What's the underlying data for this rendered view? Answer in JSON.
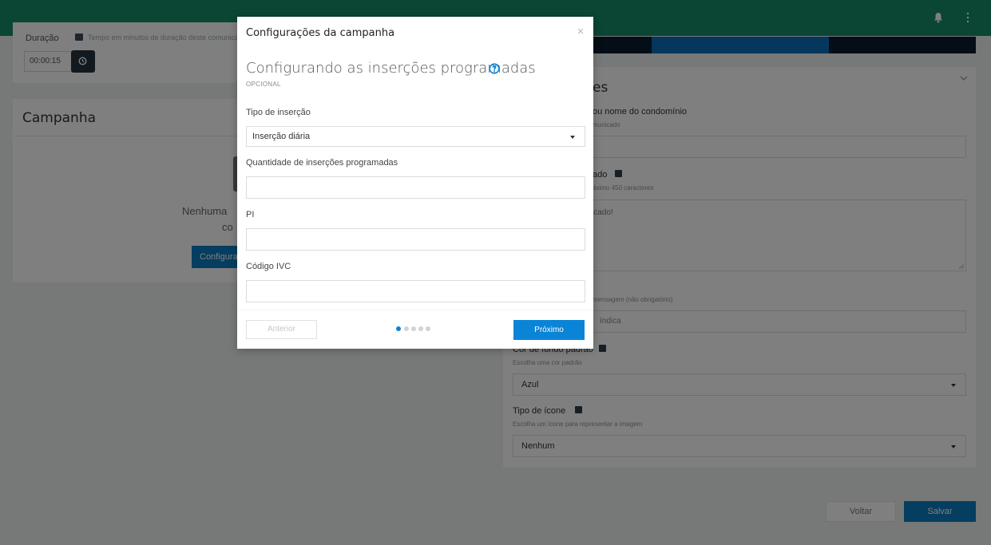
{
  "colors": {
    "topbar": "#178a66",
    "primary": "#0a7cc1",
    "modal_primary": "#0a84d6"
  },
  "topbar": {
    "icons": [
      "bell-icon",
      "kebab-menu-icon"
    ]
  },
  "duration": {
    "label": "Duração",
    "hint": "Tempo em minutos de duração deste comunicado",
    "value": "00:00:15",
    "icon": "clock-icon"
  },
  "campaign": {
    "title": "Campanha",
    "empty_text_line1": "Nenhuma",
    "empty_text_line2": "co",
    "configure_button": "Configurar"
  },
  "right_panel": {
    "title_fragment": "es",
    "name_label_fragment": "ou nome do condomínio",
    "name_hint_fragment": "municado",
    "message_label_fragment": "ado",
    "message_hint_fragment": "áximo 450 caracteres",
    "message_value_fragment": "icado!",
    "signature_hint_fragment": "mensagem (não obrigatório)",
    "signature_value_fragment": "índica",
    "bg_color_label": "Cor de fundo padrão",
    "bg_color_hint": "Escolha uma cor padrão",
    "bg_color_value": "Azul",
    "icon_type_label": "Tipo de ícone",
    "icon_type_hint": "Escolha um ícone para representar a imagem",
    "icon_type_value": "Nenhum"
  },
  "footer": {
    "back_button": "Voltar",
    "save_button": "Salvar"
  },
  "modal": {
    "title": "Configurações da campanha",
    "close": "×",
    "heading": "Configurando as inserções programadas",
    "optional": "OPCIONAL",
    "insertion_type_label": "Tipo de inserção",
    "insertion_type_value": "Inserção diária",
    "quantity_label": "Quantidade de inserções programadas",
    "quantity_value": "",
    "pi_label": "PI",
    "pi_value": "",
    "ivc_label": "Código IVC",
    "ivc_value": "",
    "prev_button": "Anterior",
    "next_button": "Próximo",
    "steps_total": 5,
    "step_current": 1
  }
}
